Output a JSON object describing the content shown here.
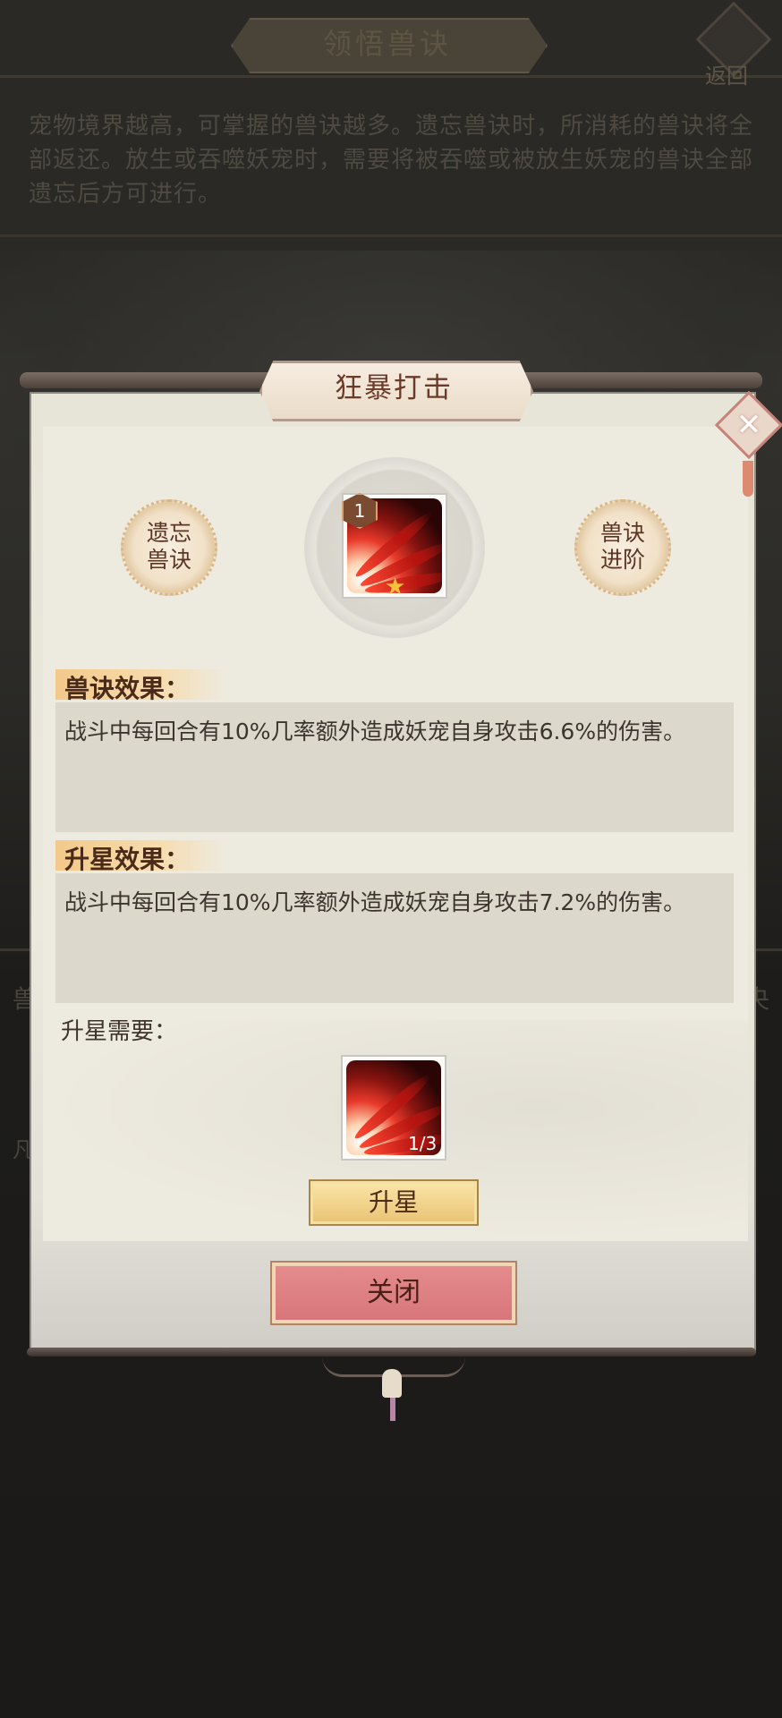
{
  "background": {
    "title": "领悟兽诀",
    "back_label": "返回",
    "description": "宠物境界越高，可掌握的兽诀越多。遗忘兽诀时，所消耗的兽诀将全部返还。放生或吞噬妖宠时，需要将被吞噬或被放生妖宠的兽诀全部遗忘后方可进行。",
    "side_left": "兽",
    "side_left_2": "凡",
    "side_right": "央"
  },
  "dialog": {
    "title": "狂暴打击",
    "close_icon": "close-x-icon",
    "forget_button": "遗忘\n兽诀",
    "advance_button": "兽诀\n进阶",
    "skill_level": "1",
    "effect_label": "兽诀效果：",
    "effect_text": "战斗中每回合有10%几率额外造成妖宠自身攻击6.6%的伤害。",
    "star_effect_label": "升星效果：",
    "star_effect_text": "战斗中每回合有10%几率额外造成妖宠自身攻击7.2%的伤害。",
    "requirement_label": "升星需要：",
    "material_count": "1/3",
    "upgrade_button": "升星",
    "close_button": "关闭"
  },
  "colors": {
    "panel": "#edeadf",
    "text_box": "#dcd8cc",
    "close_button": "#dc7d81",
    "upgrade_button": "#f0d28c",
    "title_text": "#6a3b2b"
  }
}
